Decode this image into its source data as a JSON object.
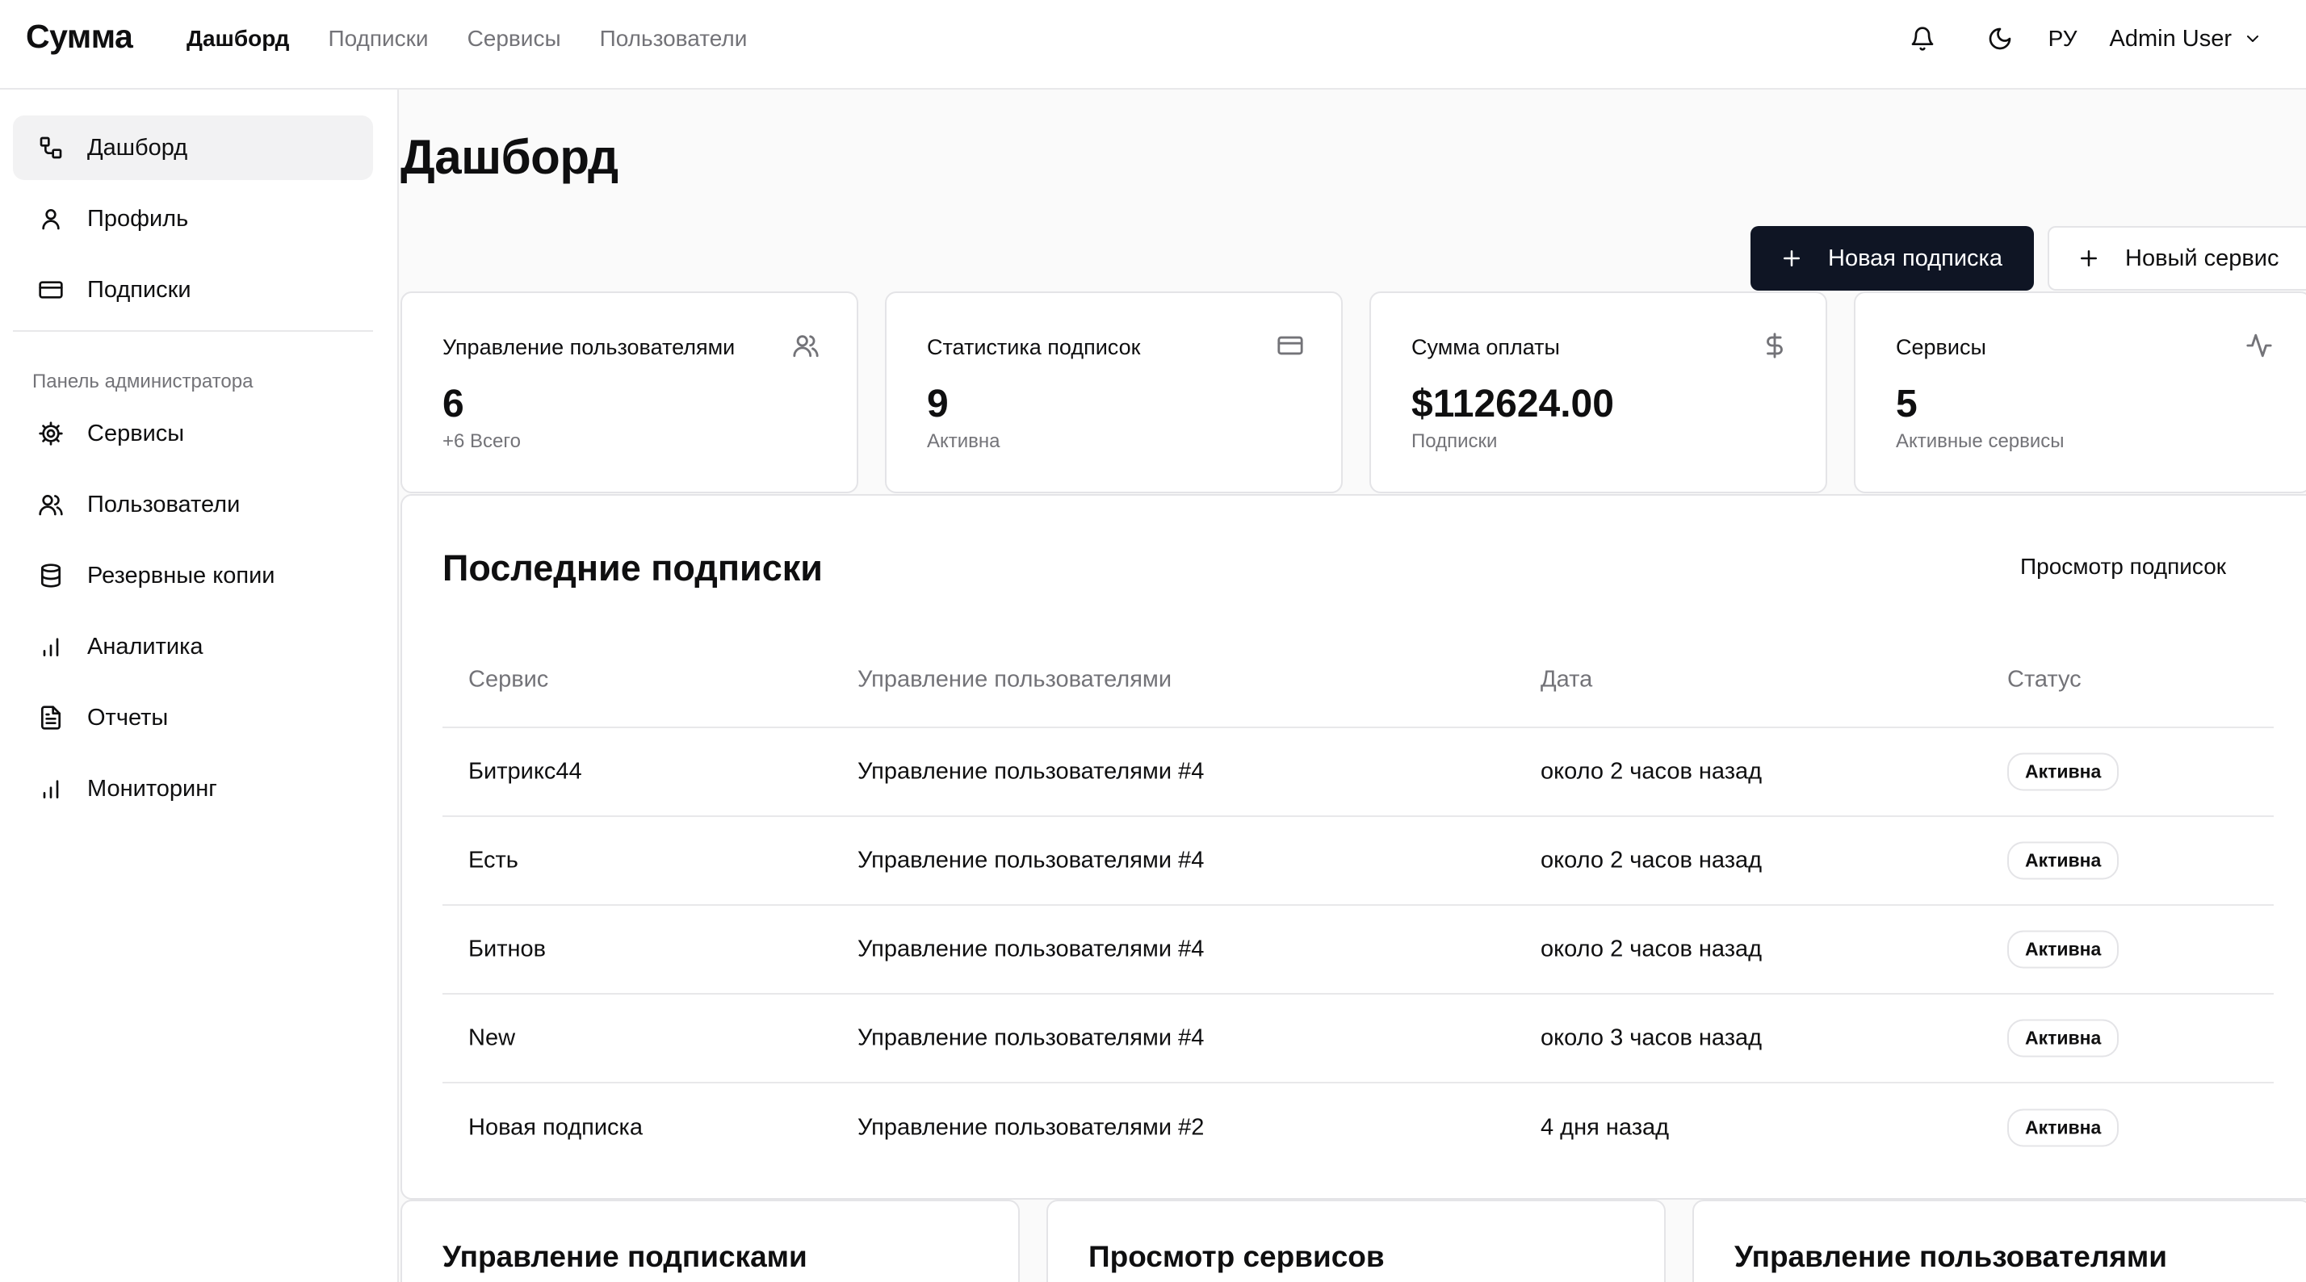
{
  "app": {
    "brand": "Сумма"
  },
  "topnav": {
    "items": [
      {
        "label": "Дашборд",
        "active": true
      },
      {
        "label": "Подписки"
      },
      {
        "label": "Сервисы"
      },
      {
        "label": "Пользователи"
      }
    ]
  },
  "header": {
    "lang": "РУ",
    "user": "Admin User",
    "icons": [
      "bell-icon",
      "moon-icon",
      "chevron-down-icon"
    ]
  },
  "sidebar": {
    "items": [
      {
        "label": "Дашборд",
        "icon": "dashboard-icon",
        "active": true
      },
      {
        "label": "Профиль",
        "icon": "user-icon"
      },
      {
        "label": "Подписки",
        "icon": "credit-card-icon"
      }
    ],
    "admin_section": "Панель администратора",
    "admin_items": [
      {
        "label": "Сервисы",
        "icon": "gear-icon"
      },
      {
        "label": "Пользователи",
        "icon": "users-icon"
      },
      {
        "label": "Резервные копии",
        "icon": "database-icon"
      },
      {
        "label": "Аналитика",
        "icon": "bar-chart-icon"
      },
      {
        "label": "Отчеты",
        "icon": "file-text-icon"
      },
      {
        "label": "Мониторинг",
        "icon": "bar-chart-icon"
      }
    ]
  },
  "main": {
    "title": "Дашборд",
    "actions": {
      "new_subscription": "Новая подписка",
      "new_service": "Новый сервис"
    },
    "stats": [
      {
        "title": "Управление пользователями",
        "value": "6",
        "sub": "+6 Всего",
        "icon": "users-icon"
      },
      {
        "title": "Статистика подписок",
        "value": "9",
        "sub": "Активна",
        "icon": "credit-card-icon"
      },
      {
        "title": "Сумма оплаты",
        "value": "$112624.00",
        "sub": "Подписки",
        "icon": "dollar-icon"
      },
      {
        "title": "Сервисы",
        "value": "5",
        "sub": "Активные сервисы",
        "icon": "activity-icon"
      }
    ],
    "recent": {
      "title": "Последние подписки",
      "link": "Просмотр подписок",
      "columns": [
        "Сервис",
        "Управление пользователями",
        "Дата",
        "Статус"
      ],
      "rows": [
        [
          "Битрикс44",
          "Управление пользователями #4",
          "около 2 часов назад",
          "Активна"
        ],
        [
          "Есть",
          "Управление пользователями #4",
          "около 2 часов назад",
          "Активна"
        ],
        [
          "Битнов",
          "Управление пользователями #4",
          "около 2 часов назад",
          "Активна"
        ],
        [
          "New",
          "Управление пользователями #4",
          "около 3 часов назад",
          "Активна"
        ],
        [
          "Новая подписка",
          "Управление пользователями #2",
          "4 дня назад",
          "Активна"
        ]
      ]
    },
    "bottom_cards": [
      "Управление подписками",
      "Просмотр сервисов",
      "Управление пользователями"
    ]
  },
  "colors": {
    "primary_button": "#0f1524",
    "muted_text": "#737378",
    "border": "#e4e4e7"
  }
}
